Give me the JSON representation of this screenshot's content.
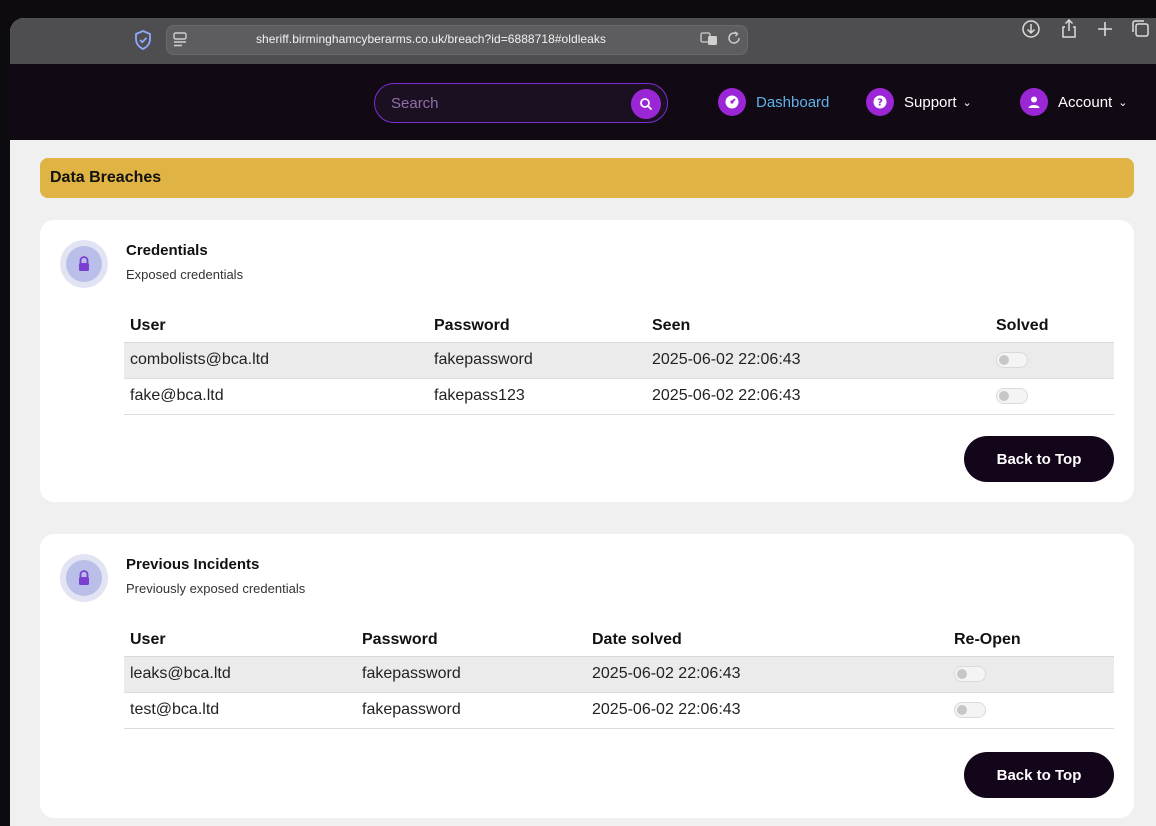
{
  "browser": {
    "url": "sheriff.birminghamcyberarms.co.uk/breach?id=6888718#oldleaks"
  },
  "navbar": {
    "search_placeholder": "Search",
    "dashboard_label": "Dashboard",
    "support_label": "Support",
    "account_label": "Account"
  },
  "banner": {
    "title": "Data Breaches"
  },
  "credentials": {
    "title": "Credentials",
    "subtitle": "Exposed credentials",
    "columns": [
      "User",
      "Password",
      "Seen",
      "Solved"
    ],
    "rows": [
      {
        "user": "combolists@bca.ltd",
        "password": "fakepassword",
        "seen": "2025-06-02 22:06:43",
        "solved": false
      },
      {
        "user": "fake@bca.ltd",
        "password": "fakepass123",
        "seen": "2025-06-02 22:06:43",
        "solved": false
      }
    ],
    "back_label": "Back to Top"
  },
  "previous": {
    "title": "Previous Incidents",
    "subtitle": "Previously exposed credentials",
    "columns": [
      "User",
      "Password",
      "Date solved",
      "Re-Open"
    ],
    "rows": [
      {
        "user": "leaks@bca.ltd",
        "password": "fakepassword",
        "date": "2025-06-02 22:06:43",
        "reopen": false
      },
      {
        "user": "test@bca.ltd",
        "password": "fakepassword",
        "date": "2025-06-02 22:06:43",
        "reopen": false
      }
    ],
    "back_label": "Back to Top"
  },
  "colors": {
    "accent": "#9b26d6",
    "banner": "#e0b444",
    "navbar": "#110a14",
    "active_link": "#5fb2e8"
  },
  "icons": [
    "shield-icon",
    "tabs-icon",
    "translate-icon",
    "reload-icon",
    "download-icon",
    "share-icon",
    "new-tab-icon",
    "tab-overview-icon",
    "search-icon",
    "dashboard-icon",
    "help-icon",
    "user-icon",
    "lock-icon"
  ]
}
